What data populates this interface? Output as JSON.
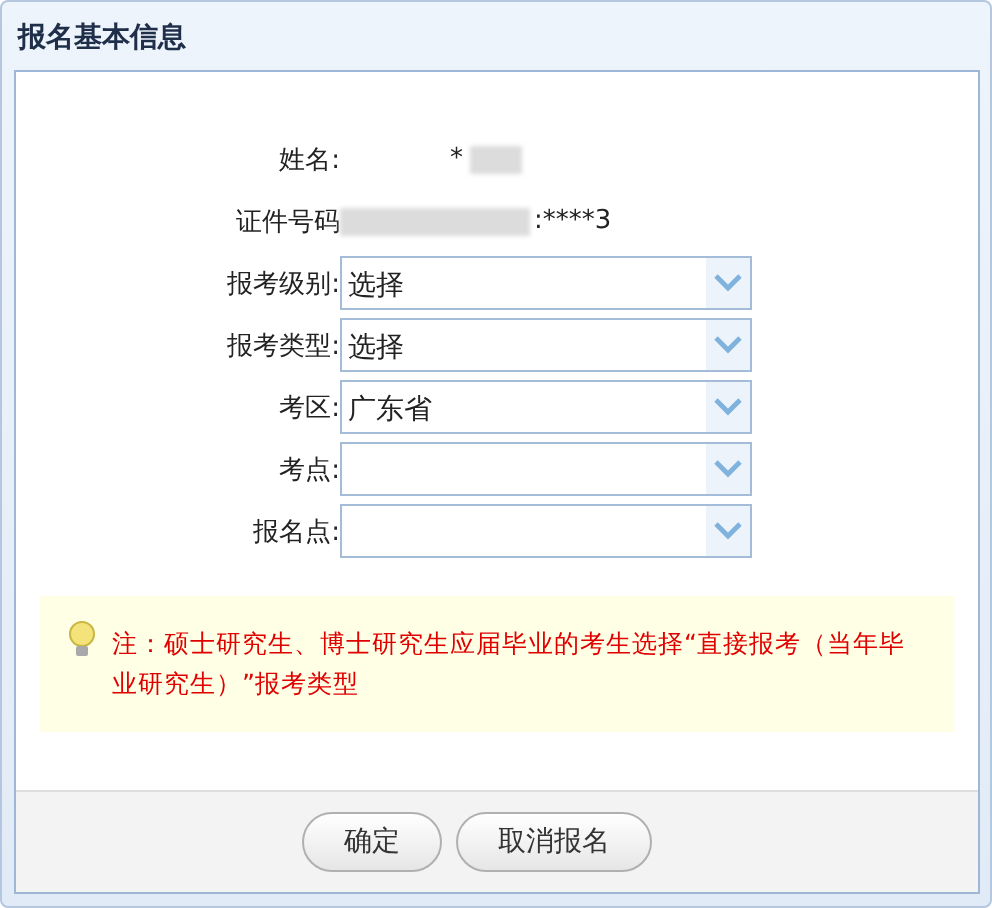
{
  "window": {
    "title": "报名基本信息"
  },
  "info": [
    {
      "label": "姓名:",
      "value": "*",
      "redacted": true
    },
    {
      "label": "证件号码",
      "value": ":****3",
      "redacted": true
    }
  ],
  "selects": [
    {
      "label": "报考级别:",
      "value": "选择"
    },
    {
      "label": "报考类型:",
      "value": "选择"
    },
    {
      "label": "考区:",
      "value": "广东省"
    },
    {
      "label": "考点:"
    },
    {
      "label": "报名点:"
    }
  ],
  "note": "注：硕士研究生、博士研究生应届毕业的考生选择“直接报考（当年毕业研究生）”报考类型",
  "buttons": [
    "确定",
    "取消报名"
  ]
}
